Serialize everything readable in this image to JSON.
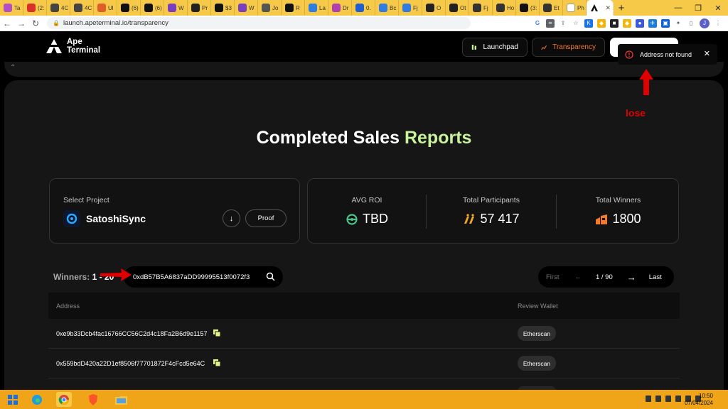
{
  "browser": {
    "tabs": [
      {
        "label": "Ta",
        "icon": "sparkle-icon",
        "color": "#b44fc7"
      },
      {
        "label": "(2:",
        "icon": "news-icon",
        "color": "#d9302b"
      },
      {
        "label": "4C",
        "icon": "globe-icon",
        "color": "#444444"
      },
      {
        "label": "4C",
        "icon": "globe-icon",
        "color": "#444444"
      },
      {
        "label": "Ul",
        "icon": "circle-icon",
        "color": "#e05d2a"
      },
      {
        "label": "(6)",
        "icon": "x-icon",
        "color": "#111111"
      },
      {
        "label": "(6)",
        "icon": "x-icon",
        "color": "#111111"
      },
      {
        "label": "W",
        "icon": "app-icon",
        "color": "#7a3fc0"
      },
      {
        "label": "Pr",
        "icon": "diamond-icon",
        "color": "#222222"
      },
      {
        "label": "$3",
        "icon": "check-icon",
        "color": "#111111"
      },
      {
        "label": "W",
        "icon": "app-icon",
        "color": "#7a3fc0"
      },
      {
        "label": "Jo",
        "icon": "doc-icon",
        "color": "#555555"
      },
      {
        "label": "R",
        "icon": "rocket-icon",
        "color": "#111111"
      },
      {
        "label": "La",
        "icon": "c-icon",
        "color": "#2f7de1"
      },
      {
        "label": "Dr",
        "icon": "d-icon",
        "color": "#b03fb3"
      },
      {
        "label": "0.",
        "icon": "cloud-icon",
        "color": "#1f5fd0"
      },
      {
        "label": "Bc",
        "icon": "c-icon",
        "color": "#2f7de1"
      },
      {
        "label": "Fj",
        "icon": "c-icon",
        "color": "#2f7de1"
      },
      {
        "label": "O",
        "icon": "box-icon",
        "color": "#222222"
      },
      {
        "label": "Ot",
        "icon": "box-icon",
        "color": "#222222"
      },
      {
        "label": "Fj",
        "icon": "globe-icon",
        "color": "#333333"
      },
      {
        "label": "Ho",
        "icon": "globe-icon",
        "color": "#333333"
      },
      {
        "label": "(3:",
        "icon": "x-icon",
        "color": "#111111"
      },
      {
        "label": "Et",
        "icon": "globe-icon",
        "color": "#333333"
      },
      {
        "label": "Ph",
        "icon": "h-icon",
        "color": "#ffffff"
      }
    ],
    "active_tab": {
      "label": "",
      "icon": "ape-icon"
    },
    "new_tab": "+",
    "url": "launch.apeterminal.io/transparency",
    "profile_initial": "J"
  },
  "site": {
    "logo_line1": "Ape",
    "logo_line2": "Terminal",
    "nav_launchpad": "Launchpad",
    "nav_transparency": "Transparency"
  },
  "main": {
    "heading_white": "Completed Sales",
    "heading_green": "Reports",
    "select_project_label": "Select Project",
    "project_name": "SatoshiSync",
    "proof_label": "Proof",
    "stats": [
      {
        "label": "AVG ROI",
        "value": "TBD",
        "icon": "roi-icon",
        "color": "#4cc38a"
      },
      {
        "label": "Total Participants",
        "value": "57 417",
        "icon": "participants-icon",
        "color": "#f5a623"
      },
      {
        "label": "Total Winners",
        "value": "1800",
        "icon": "winners-icon",
        "color": "#f37a2a"
      }
    ],
    "winners_label": "Winners:",
    "winners_range": "1 - 20",
    "search_value": "0xdB57B5A6837aDD99995513f0072f3",
    "pager": {
      "first": "First",
      "prev": "←",
      "page": "1 / 90",
      "next": "→",
      "last": "Last"
    },
    "table": {
      "col_address": "Address",
      "col_review": "Review Wallet",
      "rows": [
        {
          "address": "0xe9b33Dcb4fac16766CC56C2d4c18Fa2B6d9e1157",
          "action": "Etherscan"
        },
        {
          "address": "0x559bdD420a22D1ef8506f77701872F4cFcd5e64C",
          "action": "Etherscan"
        }
      ]
    }
  },
  "toast": {
    "message": "Address not found",
    "color": "#e53935"
  },
  "annotation": {
    "text": "lose",
    "color": "#e00000"
  },
  "taskbar": {
    "time": "10:50",
    "date": "07/04/2024"
  }
}
